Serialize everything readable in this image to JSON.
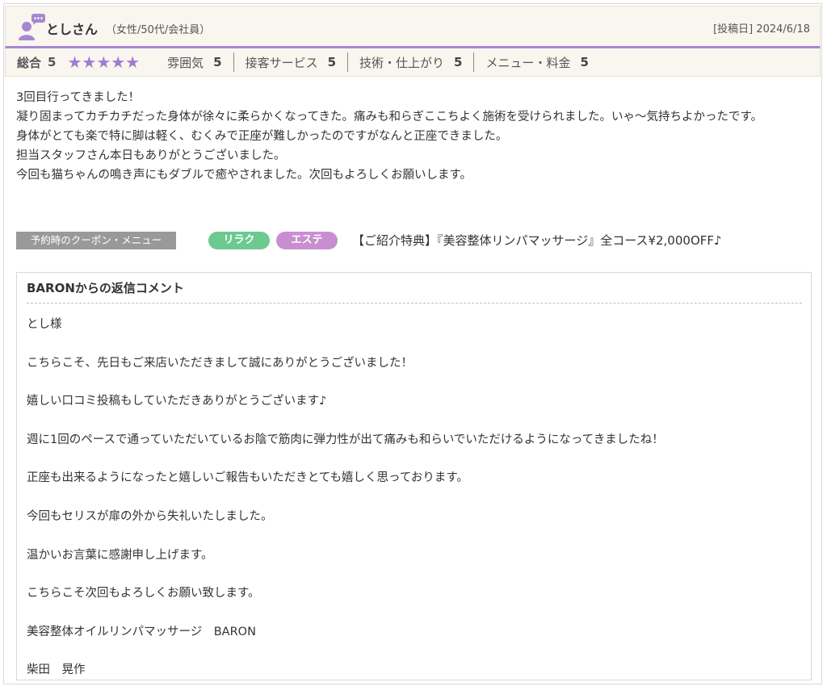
{
  "review": {
    "reviewer_name": "としさん",
    "reviewer_attrs": "（女性/50代/会社員）",
    "posted_label": "[投稿日] 2024/6/18",
    "avatar_icon": "person-chat-icon",
    "accent_color": "#a786d1",
    "ratings": {
      "total_label": "総合",
      "total_value": "5",
      "stars": "★★★★★",
      "star_count": 5,
      "star_color": "#a07bd6",
      "items": [
        {
          "label": "雰囲気",
          "value": "5"
        },
        {
          "label": "接客サービス",
          "value": "5"
        },
        {
          "label": "技術・仕上がり",
          "value": "5"
        },
        {
          "label": "メニュー・料金",
          "value": "5"
        }
      ]
    },
    "body_lines": [
      "3回目行ってきました！",
      "凝り固まってカチカチだった身体が徐々に柔らかくなってきた。痛みも和らぎここちよく施術を受けられました。いゃ～気持ちよかったです。",
      "身体がとても楽で特に脚は軽く、むくみで正座が難しかったのですがなんと正座できました。",
      "担当スタッフさん本日もありがとうございました。",
      "今回も猫ちゃんの鳴き声にもダブルで癒やされました。次回もよろしくお願いします。"
    ],
    "coupon": {
      "label": "予約時のクーポン・メニュー",
      "tags": [
        {
          "label": "リラク",
          "color": "#6cc98f"
        },
        {
          "label": "エステ",
          "color": "#c88fd0"
        }
      ],
      "text": "【ご紹介特典】『美容整体リンパマッサージ』全コース¥2,000OFF♪"
    }
  },
  "reply": {
    "title": "BARONからの返信コメント",
    "lines": [
      "とし様",
      "こちらこそ、先日もご来店いただきまして誠にありがとうございました！",
      "嬉しい口コミ投稿もしていただきありがとうございます♪",
      "週に1回のペースで通っていただいているお陰で筋肉に弾力性が出て痛みも和らいでいただけるようになってきましたね！",
      "正座も出来るようになったと嬉しいご報告もいただきとても嬉しく思っております。",
      "今回もセリスが扉の外から失礼いたしました。",
      "温かいお言葉に感謝申し上げます。",
      "こちらこそ次回もよろしくお願い致します。",
      "美容整体オイルリンパマッサージ　BARON",
      "柴田　晃作"
    ]
  }
}
